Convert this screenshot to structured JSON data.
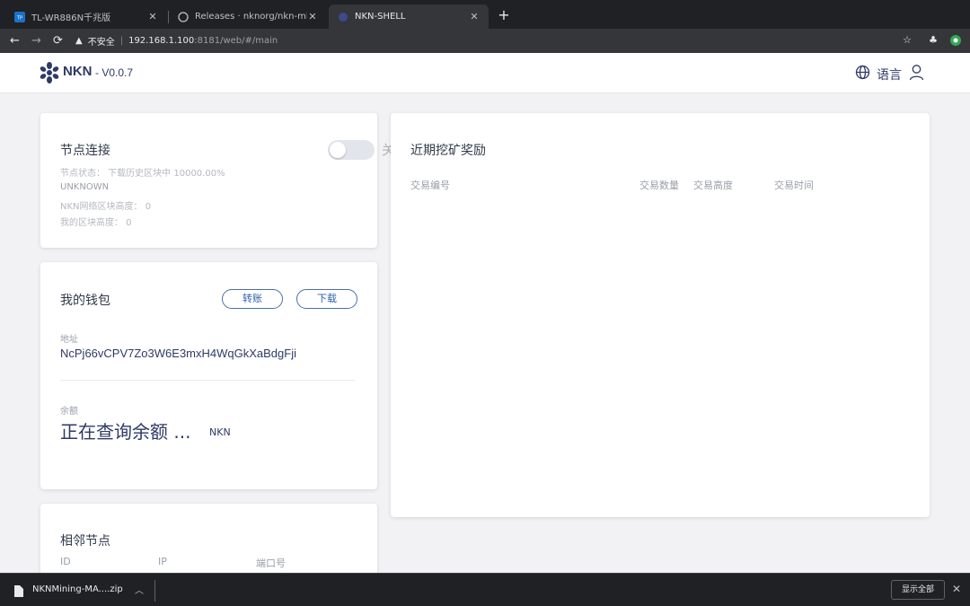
{
  "browser": {
    "tabs": [
      {
        "title": "TL-WR886N千兆版",
        "favicon": "tp-link-favicon"
      },
      {
        "title": "Releases · nknorg/nkn-mining",
        "favicon": "github-favicon"
      },
      {
        "title": "NKN-SHELL",
        "favicon": "nkn-favicon",
        "active": true
      }
    ],
    "new_tab": "+",
    "address": {
      "insecure_label": "不安全",
      "separator": "|",
      "host": "192.168.1.100",
      "path": ":8181/web/#/main"
    },
    "icons": [
      "back-icon",
      "forward-icon",
      "reload-icon",
      "star-icon",
      "extension-icon",
      "profile-icon"
    ]
  },
  "app": {
    "brand": "NKN",
    "version": "- V0.0.7",
    "language_label": "语言"
  },
  "node_card": {
    "title": "节点连接",
    "toggle_label": "关",
    "toggle_on": false,
    "status_line": "节点状态： 下载历史区块中 10000.00%",
    "status_value": "UNKNOWN",
    "network_height": "NKN网络区块高度： 0",
    "my_height": "我的区块高度： 0"
  },
  "wallet_card": {
    "title": "我的钱包",
    "transfer_label": "转账",
    "download_label": "下载",
    "address_label": "地址",
    "address_value": "NcPj66vCPV7Zo3W6E3mxH4WqGkXaBdgFji",
    "balance_label": "余额",
    "balance_value": "正在查询余额 ...",
    "balance_unit": "NKN"
  },
  "neighbors_card": {
    "title": "相邻节点",
    "columns": [
      "ID",
      "IP",
      "端口号"
    ]
  },
  "rewards_card": {
    "title": "近期挖矿奖励",
    "columns": [
      "交易编号",
      "交易数量",
      "交易高度",
      "交易时间"
    ]
  },
  "download_bar": {
    "filename": "NKNMining-MA....zip",
    "show_all_label": "显示全部"
  },
  "colors": {
    "brand": "#2f3a66",
    "button_border": "#4c6fa8",
    "browser_dark": "#202124"
  }
}
